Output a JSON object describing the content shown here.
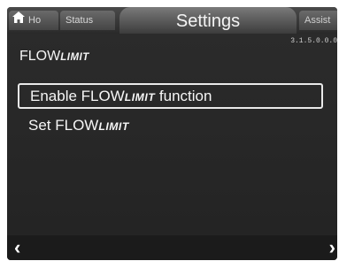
{
  "tabs": {
    "home_label": "Ho",
    "status_label": "Status",
    "settings_label": "Settings",
    "assist_label": "Assist"
  },
  "version": "3.1.5.0.0.0",
  "page": {
    "title_main": "FLOW",
    "title_sc": "LIMIT"
  },
  "menu": {
    "items": [
      {
        "main": "Enable FLOW",
        "sc": "LIMIT",
        "suffix": " function",
        "selected": true
      },
      {
        "main": "Set FLOW",
        "sc": "LIMIT",
        "suffix": "",
        "selected": false
      }
    ]
  },
  "nav": {
    "left_arrow": "‹",
    "right_arrow": "›"
  },
  "colors": {
    "screen_bg": "#2a2a2a",
    "text": "#f0f0f0",
    "selection_border": "#e9e9e9"
  },
  "icons": {
    "home": "home-icon",
    "left": "chevron-left-icon",
    "right": "chevron-right-icon"
  }
}
